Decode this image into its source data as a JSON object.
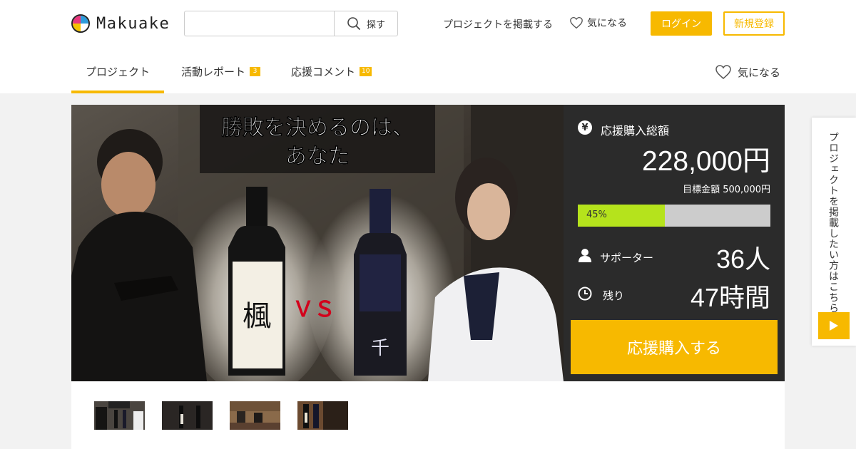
{
  "brand": {
    "name": "Makuake"
  },
  "search": {
    "button_label": "探す",
    "placeholder": ""
  },
  "header_nav": {
    "post_project": "プロジェクトを掲載する",
    "favorite": "気になる",
    "login": "ログイン",
    "signup": "新規登録"
  },
  "tabs": [
    {
      "label": "プロジェクト",
      "badge": ""
    },
    {
      "label": "活動レポート",
      "badge": "3"
    },
    {
      "label": "応援コメント",
      "badge": "10"
    }
  ],
  "tab_favorite": "気になる",
  "hero": {
    "headline_line1": "勝敗を決めるのは、",
    "headline_line2": "あなた",
    "vs_text": "ＶＳ"
  },
  "stats": {
    "total_label": "応援購入総額",
    "yen_symbol": "¥",
    "amount": "228,000円",
    "goal": "目標金額 500,000円",
    "progress_percent": 45,
    "progress_text": "45%",
    "supporters_label": "サポーター",
    "supporters": "36人",
    "remaining_label": "残り",
    "remaining": "47時間",
    "buy_button": "応援購入する"
  },
  "side_tab": {
    "text": "プロジェクトを掲載したい方はこちら"
  },
  "colors": {
    "accent": "#f7b900",
    "progress": "#b5e31c",
    "panel": "#2b2b2b"
  }
}
